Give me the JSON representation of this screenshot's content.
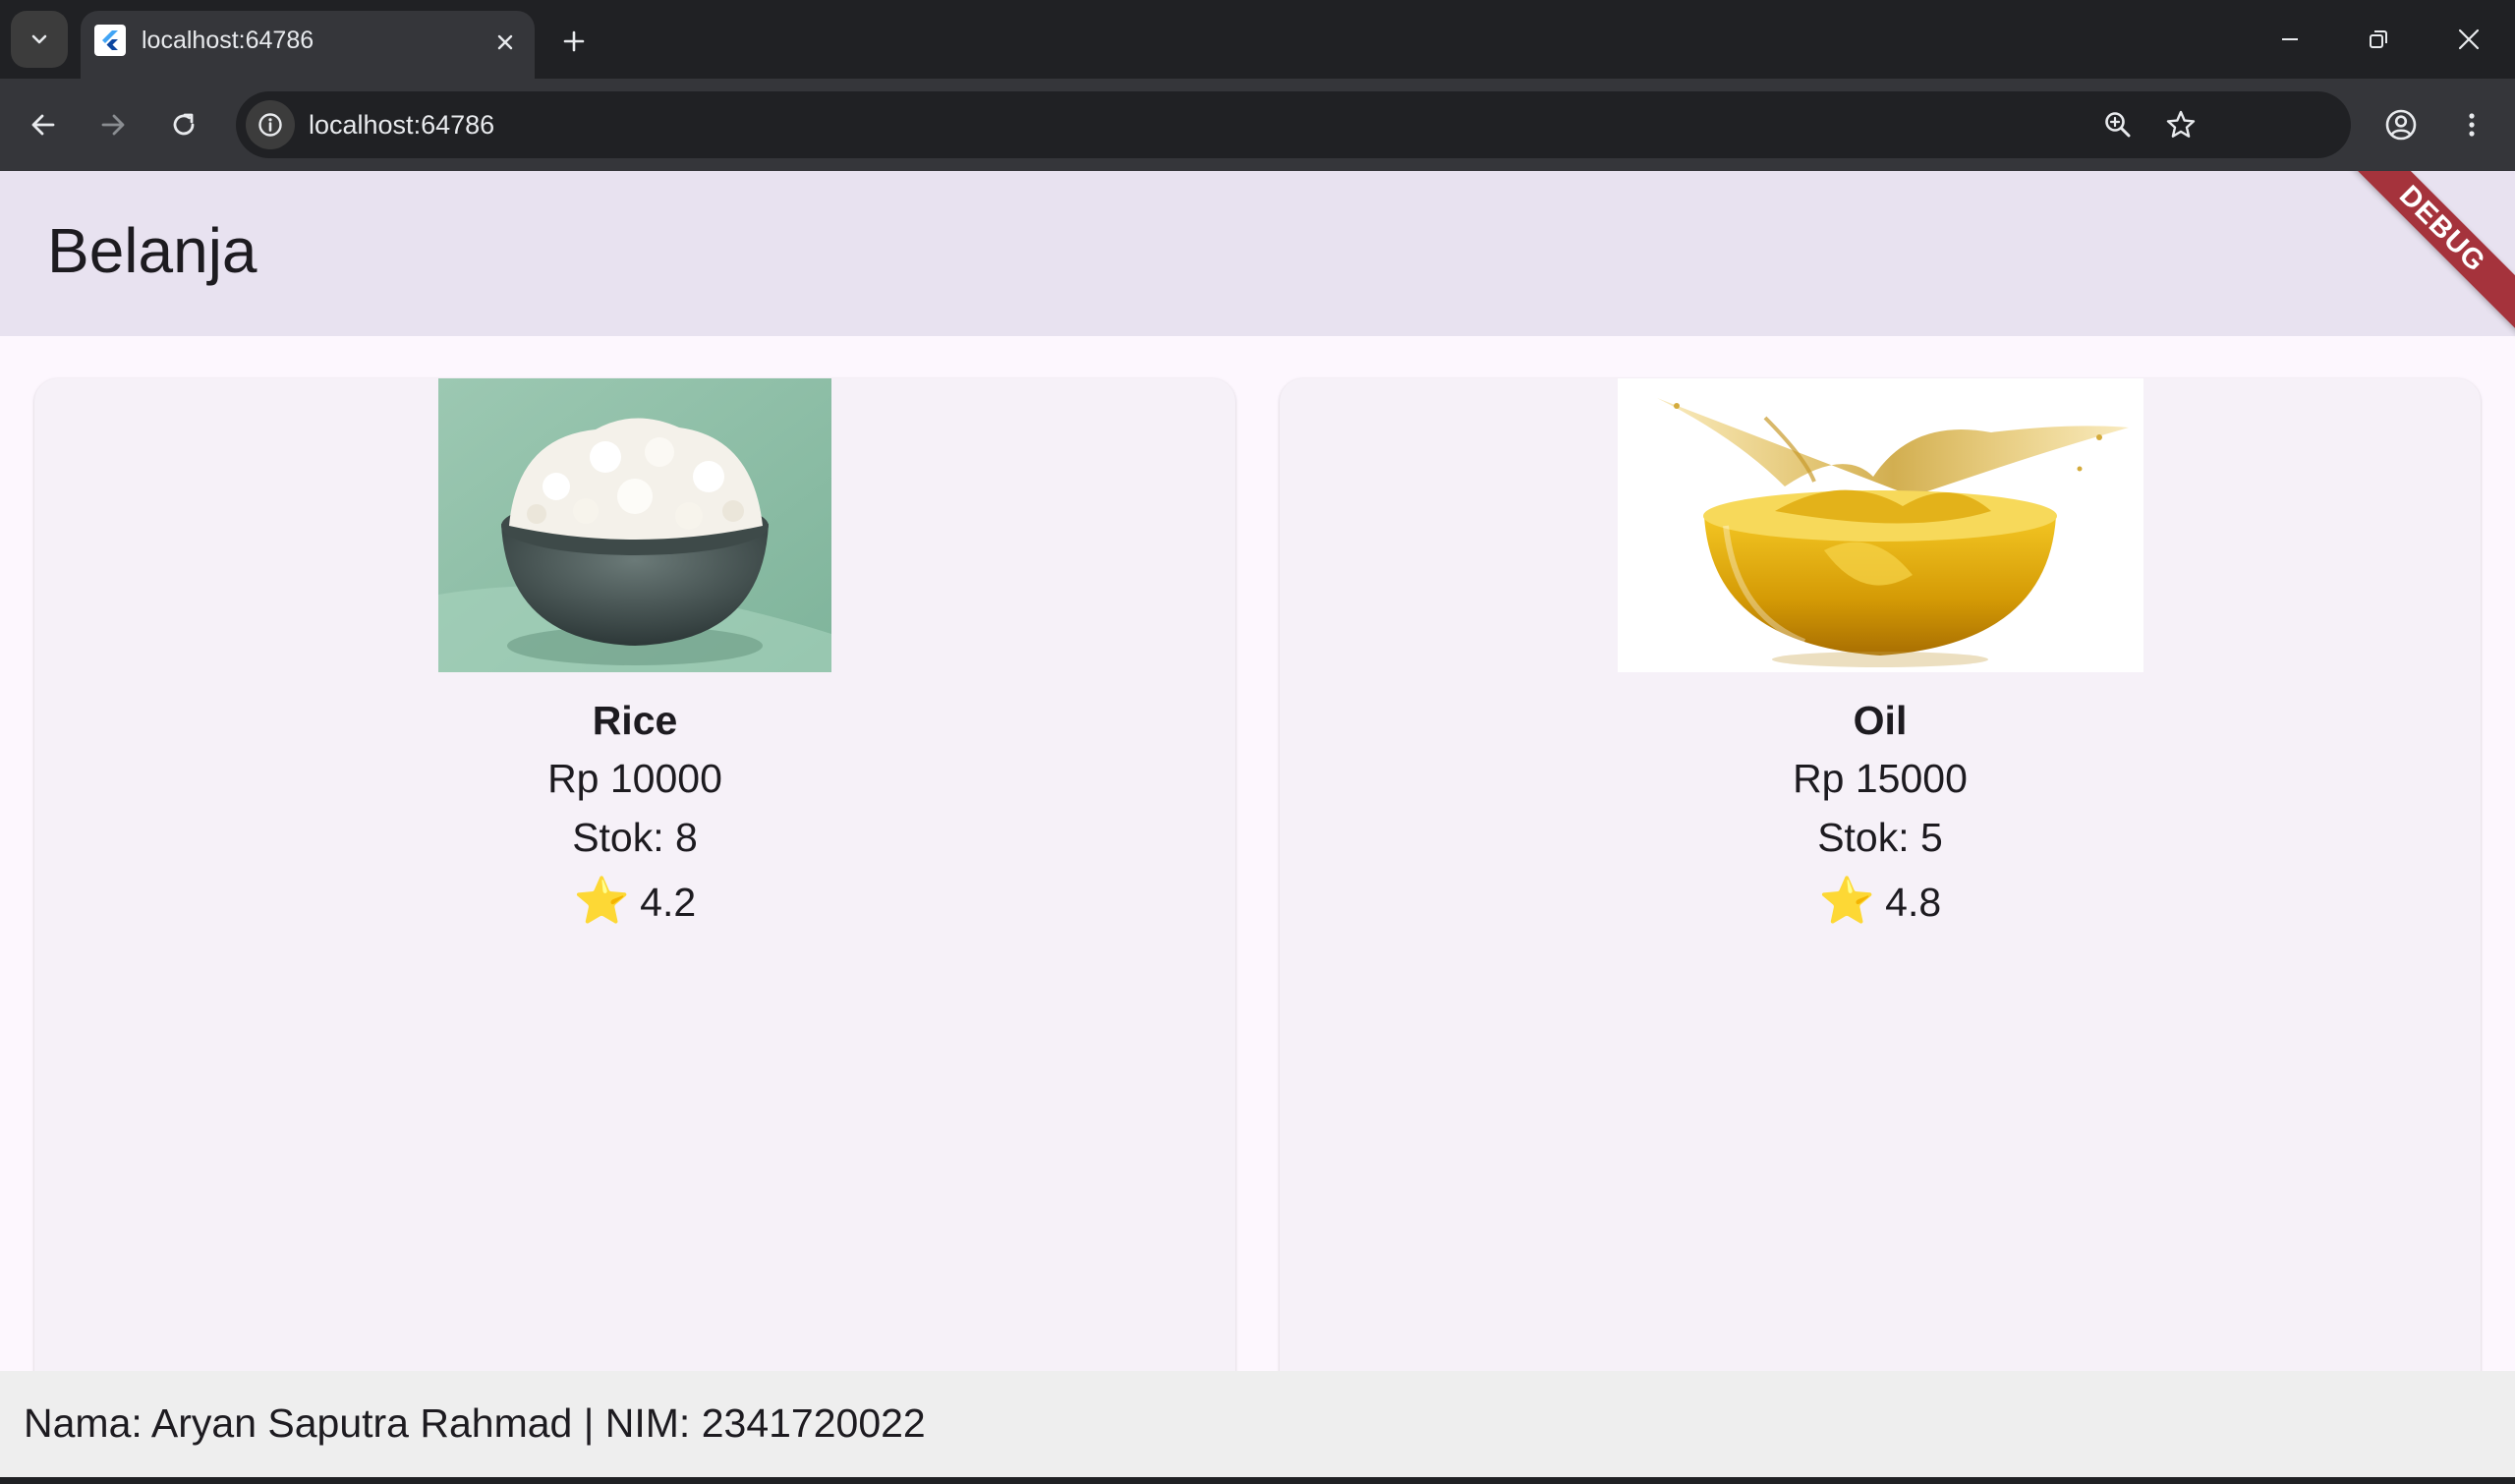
{
  "browser": {
    "tab": {
      "title": "localhost:64786"
    },
    "address_bar": {
      "url": "localhost:64786"
    },
    "icons": [
      "tab-search-icon",
      "flutter-icon",
      "close-icon",
      "plus-icon",
      "minimize-icon",
      "restore-icon",
      "back-icon",
      "forward-icon",
      "reload-icon",
      "info-icon",
      "zoom-icon",
      "star-icon",
      "profile-icon",
      "more-icon"
    ]
  },
  "app": {
    "title": "Belanja",
    "debug_banner": "DEBUG",
    "products": [
      {
        "name": "Rice",
        "price": "Rp 10000",
        "stock": "Stok: 8",
        "rating_icon": "⭐",
        "rating": "4.2",
        "image_icon": "rice-bowl-image"
      },
      {
        "name": "Oil",
        "price": "Rp 15000",
        "stock": "Stok: 5",
        "rating_icon": "⭐",
        "rating": "4.8",
        "image_icon": "oil-bowl-image"
      }
    ],
    "footer": "Nama: Aryan Saputra Rahmad | NIM: 2341720022"
  },
  "colors": {
    "appbar_bg": "#e8e2f0",
    "page_bg": "#fdf7fe",
    "card_bg": "#f6f1f8",
    "debug_banner": "#a5333c",
    "chrome_dark": "#202124",
    "chrome_toolbar": "#35363a"
  }
}
